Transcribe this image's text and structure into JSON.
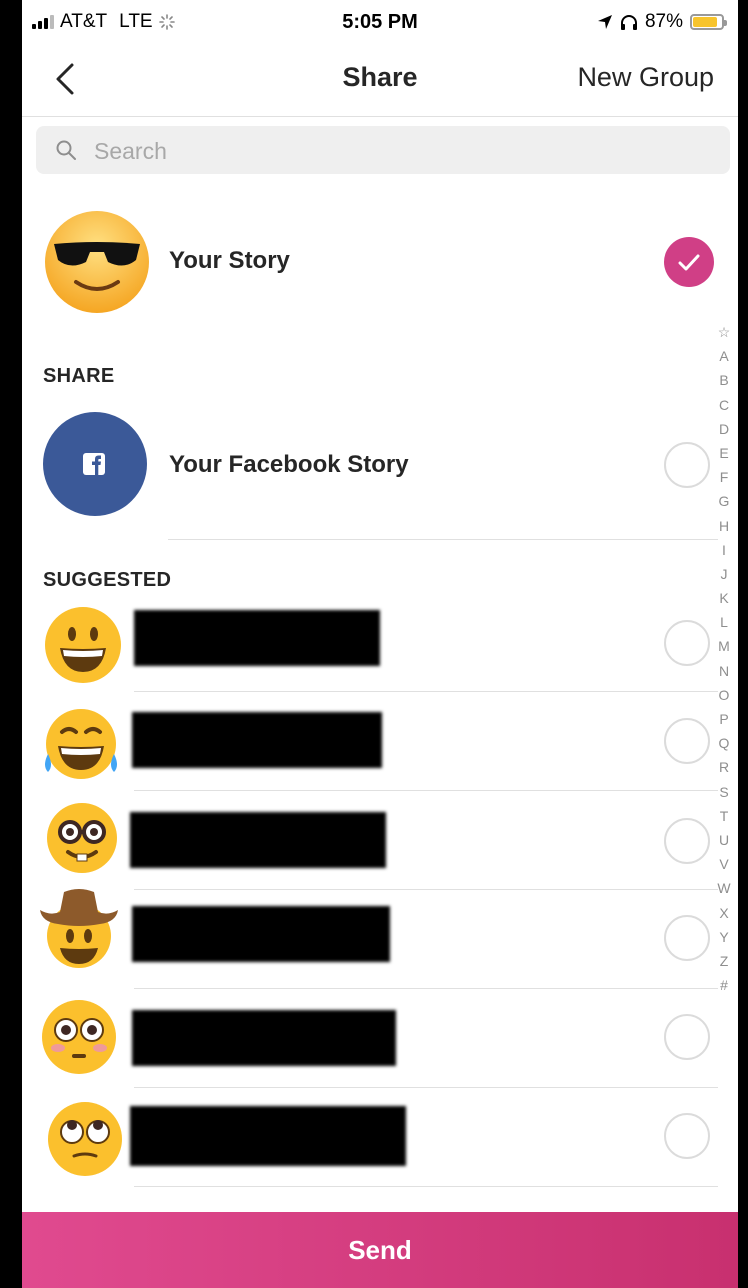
{
  "status_bar": {
    "carrier": "AT&T",
    "network": "LTE",
    "time": "5:05 PM",
    "battery": "87%",
    "battery_level": 0.87
  },
  "nav": {
    "title": "Share",
    "right_action": "New Group"
  },
  "search": {
    "placeholder": "Search",
    "value": ""
  },
  "your_story": {
    "label": "Your Story",
    "selected": true
  },
  "share_section": {
    "header": "SHARE",
    "facebook_label": "Your Facebook Story",
    "selected": false
  },
  "suggested_section": {
    "header": "SUGGESTED",
    "items": [
      {
        "avatar": "grinning-face-icon",
        "name": "",
        "selected": false
      },
      {
        "avatar": "tears-of-joy-face-icon",
        "name": "",
        "selected": false
      },
      {
        "avatar": "nerd-face-icon",
        "name": "",
        "selected": false
      },
      {
        "avatar": "cowboy-face-icon",
        "name": "",
        "selected": false
      },
      {
        "avatar": "flushed-face-icon",
        "name": "",
        "selected": false
      },
      {
        "avatar": "eye-roll-face-icon",
        "name": "",
        "selected": false
      }
    ]
  },
  "index_letters": [
    "☆",
    "A",
    "B",
    "C",
    "D",
    "E",
    "F",
    "G",
    "H",
    "I",
    "J",
    "K",
    "L",
    "M",
    "N",
    "O",
    "P",
    "Q",
    "R",
    "S",
    "T",
    "U",
    "V",
    "W",
    "X",
    "Y",
    "Z",
    "#"
  ],
  "send_button": {
    "label": "Send"
  },
  "colors": {
    "accent": "#d03f86",
    "facebook": "#3b5998"
  }
}
